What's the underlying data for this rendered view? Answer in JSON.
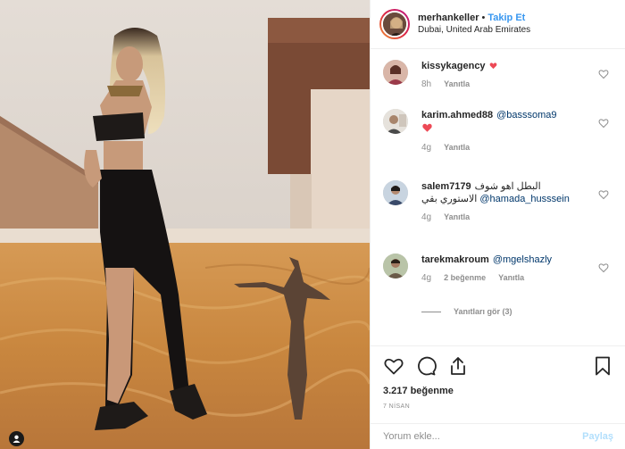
{
  "post": {
    "username": "merhankeller",
    "separator": "•",
    "follow_label": "Takip Et",
    "location": "Dubai, United Arab Emirates"
  },
  "comments": [
    {
      "user": "kissykagency",
      "text": "",
      "heart": true,
      "time": "8h",
      "reply_label": "Yanıtla",
      "likes": ""
    },
    {
      "user": "karim.ahmed88",
      "mention": "@basssoma9",
      "text": "",
      "heart": true,
      "time": "4g",
      "reply_label": "Yanıtla",
      "likes": ""
    },
    {
      "user": "salem7179",
      "text": "البطل اهو شوف",
      "mention": "@hamada_husssein",
      "text2": "الاستوري بقي",
      "time": "4g",
      "reply_label": "Yanıtla",
      "likes": ""
    },
    {
      "user": "tarekmakroum",
      "mention": "@mgelshazly",
      "text": "",
      "time": "4g",
      "reply_label": "Yanıtla",
      "likes": "2 beğenme"
    }
  ],
  "view_replies": "Yanıtları gör (3)",
  "actions": {
    "like_icon": "heart-icon",
    "comment_icon": "comment-icon",
    "share_icon": "share-icon",
    "save_icon": "bookmark-icon"
  },
  "likes_count": "3.217 beğenme",
  "date": "7 NİSAN",
  "comment_input": {
    "placeholder": "Yorum ekle...",
    "submit_label": "Paylaş"
  },
  "colors": {
    "accent": "#3897f0",
    "muted": "#8e8e8e",
    "heart": "#ed4956",
    "border": "#efefef"
  }
}
